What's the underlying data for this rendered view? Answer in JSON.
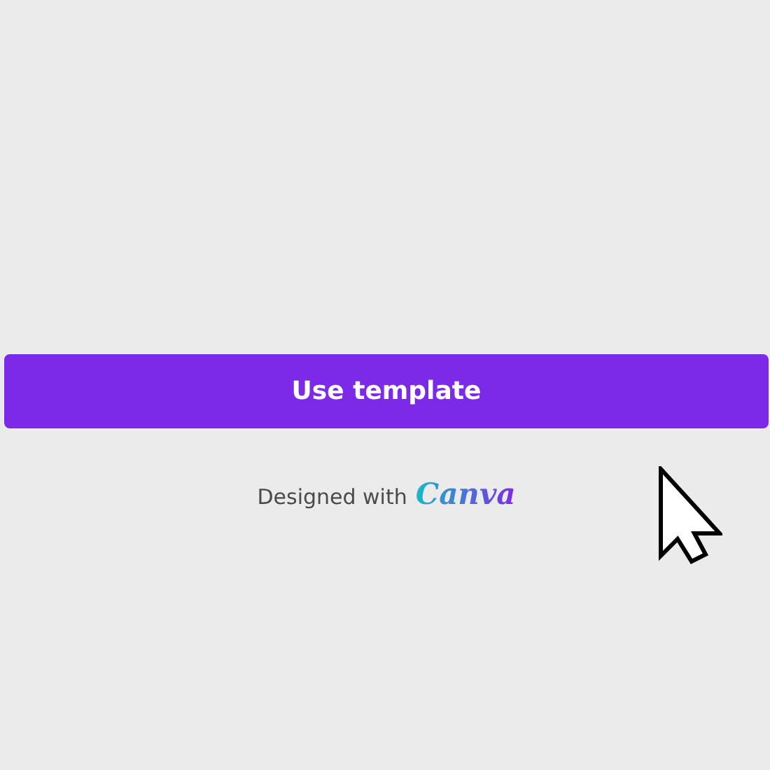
{
  "button": {
    "label": "Use template"
  },
  "credit": {
    "text": "Designed with",
    "brand": "Canva"
  }
}
